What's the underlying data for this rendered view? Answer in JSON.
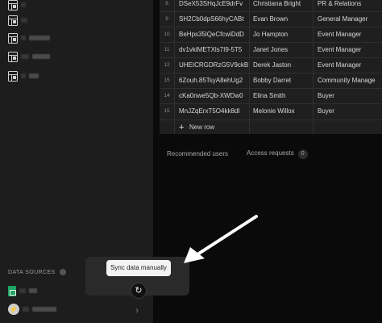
{
  "sidebar": {
    "items": [
      {
        "icon": "sheet-icon"
      },
      {
        "icon": "sheet-icon"
      },
      {
        "icon": "sheet-icon"
      },
      {
        "icon": "sheet-icon"
      },
      {
        "icon": "sheet-icon"
      }
    ],
    "data_sources_label": "DATA SOURCES"
  },
  "sync": {
    "tooltip": "Sync data manually",
    "button_icon": "↻"
  },
  "table": {
    "rows": [
      {
        "num": "8",
        "id": "DSeX53SHqJcE9drFv",
        "name": "Christiana Bright",
        "role": "PR & Relations"
      },
      {
        "num": "9",
        "id": "SH2Cb0dpS66hyCABt",
        "name": "Evan Brown",
        "role": "General Manager"
      },
      {
        "num": "10",
        "id": "BeHps35lQeCfcwiDdD",
        "name": "Jo Hampton",
        "role": "Event Manager"
      },
      {
        "num": "11",
        "id": "dv1vkiMETXls7I9-5T5",
        "name": "Janet Jones",
        "role": "Event Manager"
      },
      {
        "num": "12",
        "id": "UHEICRGDRzG5V9ckB",
        "name": "Derek Jaston",
        "role": "Event Manager"
      },
      {
        "num": "15",
        "id": "6Zouh.85TsyA8ehUg2",
        "name": "Bobby Darret",
        "role": "Community Manage"
      },
      {
        "num": "14",
        "id": "cKa0nwe5Qb-XWDw0",
        "name": "Elina Smith",
        "role": "Buyer"
      },
      {
        "num": "15",
        "id": "MnJZqErxT5O4kk8dI",
        "name": "Melonie Willox",
        "role": "Buyer"
      }
    ],
    "new_row_label": "New row",
    "new_row_icon": "+"
  },
  "tabs": {
    "recommended": "Recommended users",
    "access": "Access requests",
    "access_count": "0"
  },
  "colors": {
    "sidebar_bg": "#1d1d1d",
    "table_bg": "#1f1f1f",
    "sheet_green": "#1fa463"
  }
}
